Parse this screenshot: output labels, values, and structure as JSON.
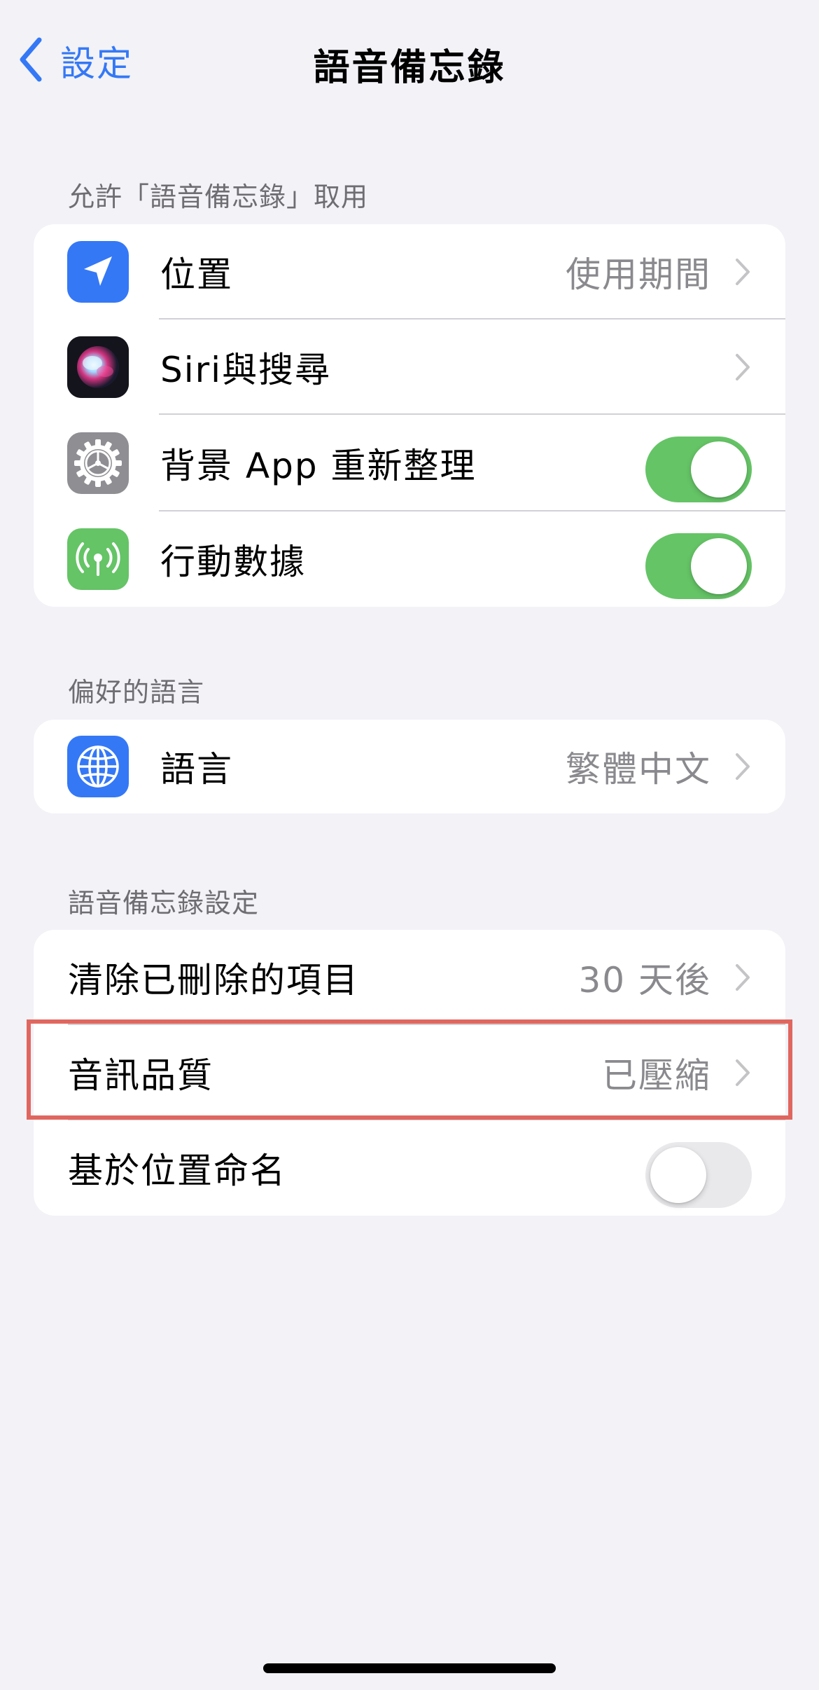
{
  "nav": {
    "back_label": "設定",
    "title": "語音備忘錄"
  },
  "sections": [
    {
      "header": "允許「語音備忘錄」取用",
      "rows": [
        {
          "icon": "location-arrow-icon",
          "label": "位置",
          "value": "使用期間",
          "control": "chevron"
        },
        {
          "icon": "siri-icon",
          "label": "Siri與搜尋",
          "value": "",
          "control": "chevron"
        },
        {
          "icon": "gear-icon",
          "label": "背景 App 重新整理",
          "control": "toggle",
          "toggle_on": true
        },
        {
          "icon": "cellular-antenna-icon",
          "label": "行動數據",
          "control": "toggle",
          "toggle_on": true
        }
      ]
    },
    {
      "header": "偏好的語言",
      "rows": [
        {
          "icon": "globe-icon",
          "label": "語言",
          "value": "繁體中文",
          "control": "chevron"
        }
      ]
    },
    {
      "header": "語音備忘錄設定",
      "rows": [
        {
          "label": "清除已刪除的項目",
          "value": "30 天後",
          "control": "chevron"
        },
        {
          "label": "音訊品質",
          "value": "已壓縮",
          "control": "chevron",
          "highlighted": true
        },
        {
          "label": "基於位置命名",
          "control": "toggle",
          "toggle_on": false
        }
      ]
    }
  ],
  "colors": {
    "accent": "#3478f6",
    "toggle_on": "#65c466",
    "highlight": "#e0675f",
    "background": "#f2f2f7"
  }
}
